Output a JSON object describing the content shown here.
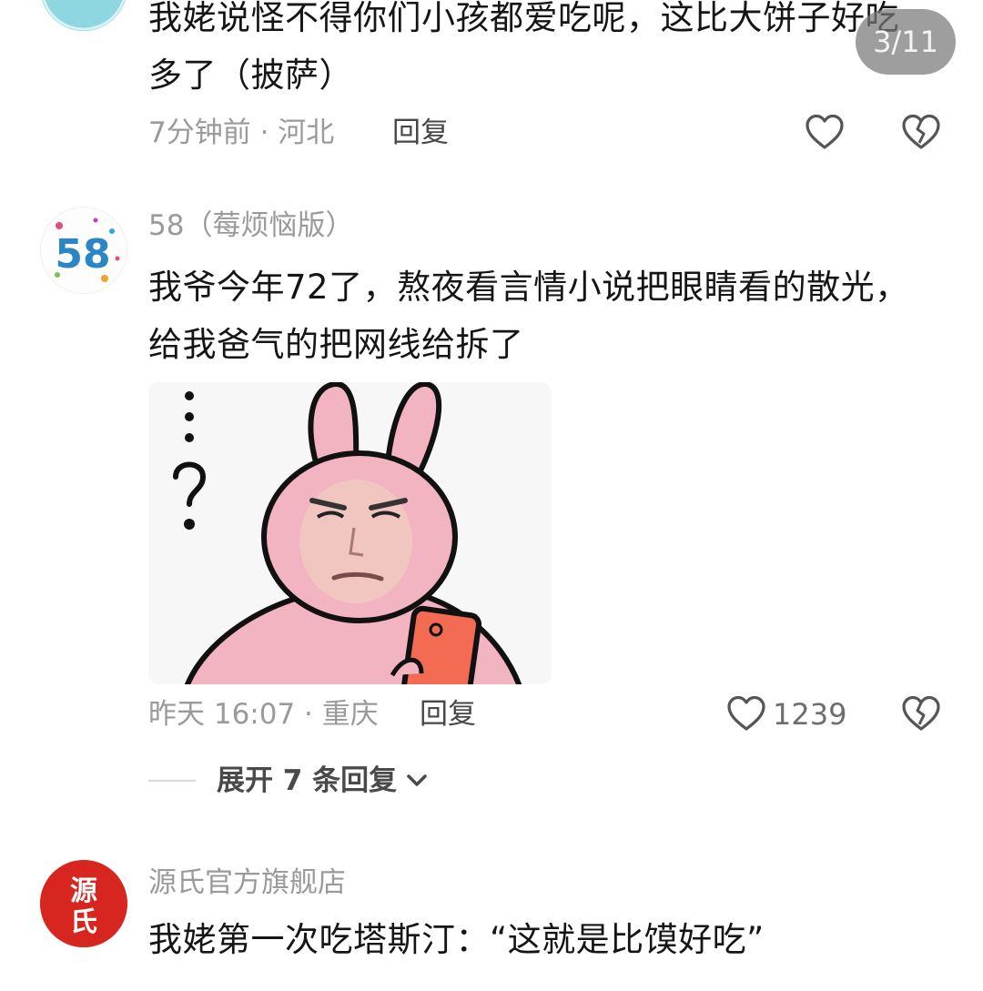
{
  "pager": {
    "label": "3/11"
  },
  "comments": [
    {
      "text_line1": "我姥说怪不得你们小孩都爱吃呢，这比大饼子好吃",
      "text_line2": "多了（披萨）",
      "time_location": "7分钟前 · 河北",
      "reply_label": "回复"
    },
    {
      "username": "58（莓烦恼版）",
      "avatar_text": "58",
      "text_line1": "我爷今年72了，熬夜看言情小说把眼睛看的散光，",
      "text_line2": "给我爸气的把网线给拆了",
      "time_location": "昨天 16:07 · 重庆",
      "reply_label": "回复",
      "like_count": "1239",
      "expand_label": "展开 7 条回复"
    },
    {
      "username": "源氏官方旗舰店",
      "avatar_text_top": "源",
      "avatar_text_bottom": "氏",
      "text_line1": "我姥第一次吃塔斯汀：“这就是比馍好吃”"
    }
  ],
  "colors": {
    "accent_red": "#d7261f",
    "meta_gray": "#9a9a9a",
    "sticker_pink": "#f2b4c0"
  }
}
